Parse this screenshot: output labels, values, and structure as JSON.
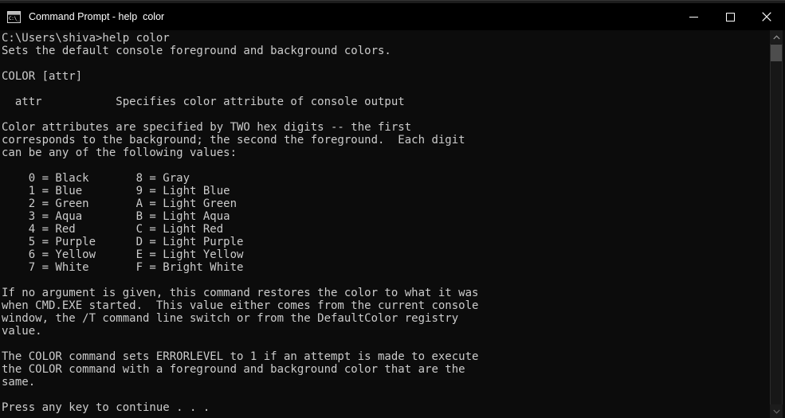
{
  "window": {
    "title": "Command Prompt - help  color",
    "icon_name": "cmd-icon",
    "icon_glyph": "C:\\_",
    "colors": {
      "titlebar_bg": "#000000",
      "console_bg": "#0c0c0c",
      "console_fg": "#cccccc",
      "title_fg": "#ffffff",
      "scrollbar_thumb": "#4d4d4d",
      "scrollbar_track": "#171717",
      "close_hover": "#c42b1c"
    },
    "controls": {
      "minimize_label": "Minimize",
      "maximize_label": "Maximize",
      "close_label": "Close"
    }
  },
  "scrollbar": {
    "up_arrow_label": "Scroll up",
    "down_arrow_label": "Scroll down",
    "thumb_label": "Scroll thumb"
  },
  "console": {
    "lines": [
      "C:\\Users\\shiva>help color",
      "Sets the default console foreground and background colors.",
      "",
      "COLOR [attr]",
      "",
      "  attr           Specifies color attribute of console output",
      "",
      "Color attributes are specified by TWO hex digits -- the first",
      "corresponds to the background; the second the foreground.  Each digit",
      "can be any of the following values:",
      "",
      "    0 = Black       8 = Gray",
      "    1 = Blue        9 = Light Blue",
      "    2 = Green       A = Light Green",
      "    3 = Aqua        B = Light Aqua",
      "    4 = Red         C = Light Red",
      "    5 = Purple      D = Light Purple",
      "    6 = Yellow      E = Light Yellow",
      "    7 = White       F = Bright White",
      "",
      "If no argument is given, this command restores the color to what it was",
      "when CMD.EXE started.  This value either comes from the current console",
      "window, the /T command line switch or from the DefaultColor registry",
      "value.",
      "",
      "The COLOR command sets ERRORLEVEL to 1 if an attempt is made to execute",
      "the COLOR command with a foreground and background color that are the",
      "same.",
      "",
      "Press any key to continue . . ."
    ]
  }
}
